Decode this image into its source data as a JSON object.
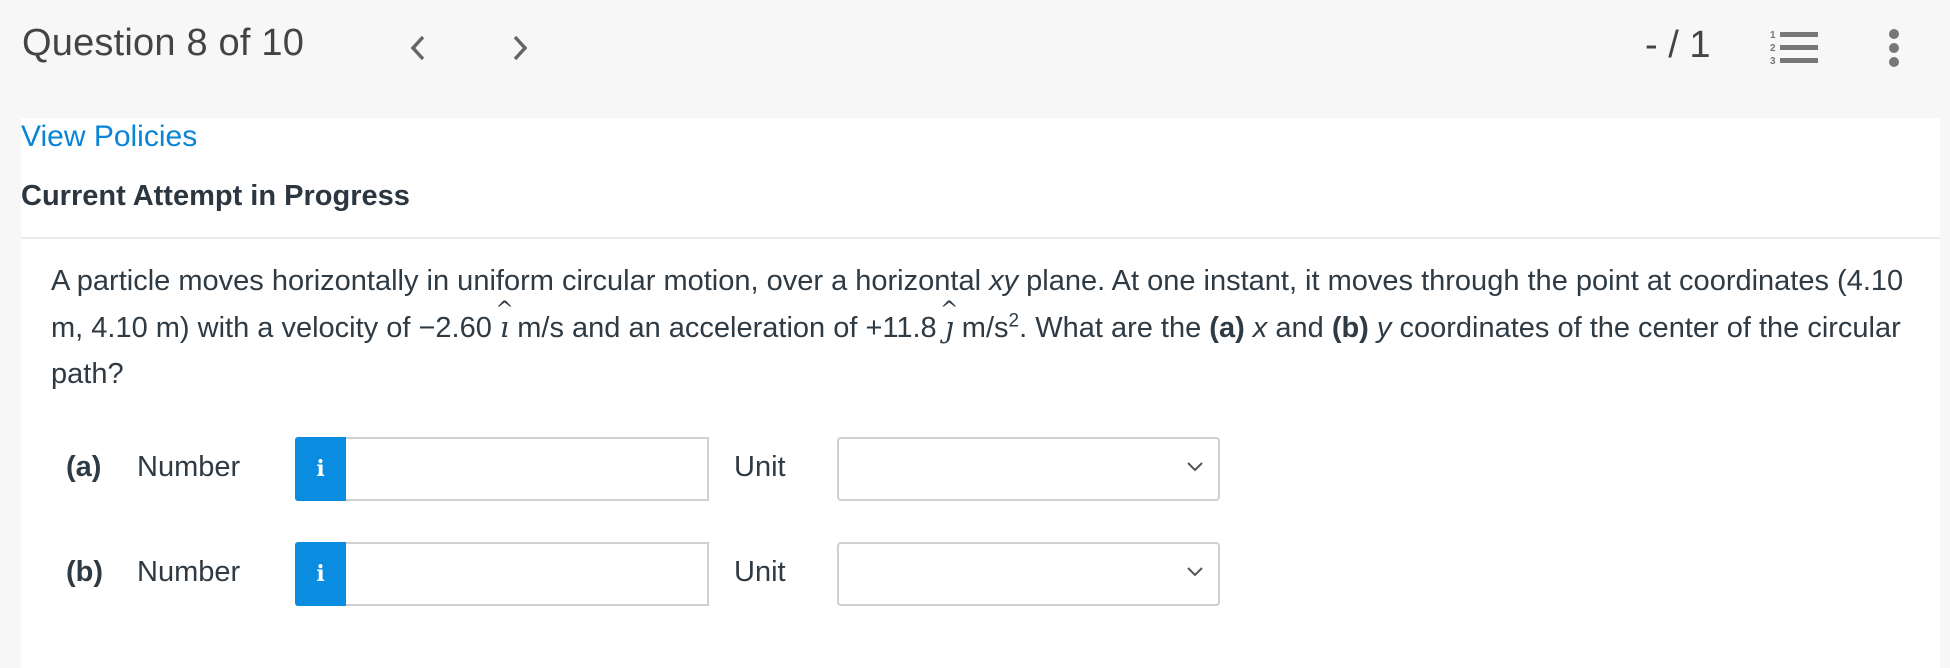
{
  "header": {
    "title": "Question 8 of 10",
    "score": "- / 1",
    "prev_icon": "chevron-left-icon",
    "next_icon": "chevron-right-icon",
    "question_list_icon": "numbered-list-icon",
    "more_icon": "kebab-menu-icon"
  },
  "links": {
    "view_policies": "View Policies"
  },
  "status": {
    "attempt": "Current Attempt in Progress"
  },
  "question": {
    "t1": "A particle moves horizontally in uniform circular motion, over a horizontal ",
    "xy": "xy",
    "t2": " plane. At one instant, it moves through the point at coordinates (4.10 m, 4.10 m) with a velocity of −2.60 ",
    "i_hat": "ı",
    "t3": " m/s and an acceleration of +11.8 ",
    "j_hat": "ȷ",
    "t4": " m/s",
    "sup": "2",
    "t5": ". What are the ",
    "a": "(a)",
    "x": " x",
    "t6": " and ",
    "b": "(b)",
    "y": " y",
    "t7": " coordinates of the center of the circular path?"
  },
  "answers": [
    {
      "part": "(a)",
      "number_label": "Number",
      "info_icon": "i",
      "number_value": "",
      "unit_label": "Unit",
      "unit_selected": ""
    },
    {
      "part": "(b)",
      "number_label": "Number",
      "info_icon": "i",
      "number_value": "",
      "unit_label": "Unit",
      "unit_selected": ""
    }
  ],
  "colors": {
    "link": "#0a84d6",
    "info_button": "#0a8ce0",
    "header_bg": "#f7f7f7"
  }
}
